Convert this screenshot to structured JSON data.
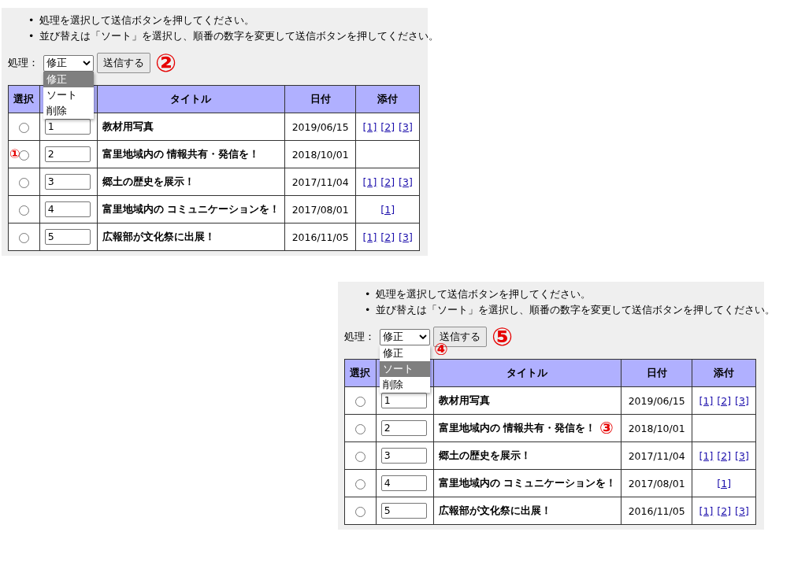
{
  "panels": [
    {
      "bullet": "•",
      "instructions": [
        "処理を選択して送信ボタンを押してください。",
        "並び替えは「ソート」を選択し、順番の数字を変更して送信ボタンを押してください。"
      ],
      "action_label": "処理：",
      "select_value": "修正",
      "options": [
        {
          "label": "修正",
          "selected": true
        },
        {
          "label": "ソート",
          "selected": false
        },
        {
          "label": "削除",
          "selected": false
        }
      ],
      "submit": "送信する",
      "columns": [
        {
          "kind": "select",
          "label": "選択"
        },
        {
          "kind": "order"
        },
        {
          "kind": "title",
          "label": "タイトル"
        },
        {
          "kind": "date",
          "label": "日付"
        },
        {
          "kind": "attach",
          "label": "添付"
        }
      ],
      "rows": [
        {
          "selected": false,
          "order": "1",
          "title": "教材用写真",
          "date": "2019/06/15",
          "attachments": [
            "[1]",
            "[2]",
            "[3]"
          ]
        },
        {
          "selected": false,
          "order": "2",
          "title": "富里地域内の 情報共有・発信を！",
          "date": "2018/10/01",
          "attachments": []
        },
        {
          "selected": false,
          "order": "3",
          "title": "郷土の歴史を展示！",
          "date": "2017/11/04",
          "attachments": [
            "[1]",
            "[2]",
            "[3]"
          ]
        },
        {
          "selected": false,
          "order": "4",
          "title": "富里地域内の コミュニケーションを！",
          "date": "2017/08/01",
          "attachments": [
            "[1]"
          ]
        },
        {
          "selected": false,
          "order": "5",
          "title": "広報部が文化祭に出展！",
          "date": "2016/11/05",
          "attachments": [
            "[1]",
            "[2]",
            "[3]"
          ]
        }
      ],
      "annotations": [
        {
          "kind": "radio",
          "label": "①"
        },
        {
          "kind": "submit",
          "label": "②"
        }
      ]
    },
    {
      "bullet": "•",
      "instructions": [
        "処理を選択して送信ボタンを押してください。",
        "並び替えは「ソート」を選択し、順番の数字を変更して送信ボタンを押してください。"
      ],
      "action_label": "処理：",
      "select_value": "修正",
      "options": [
        {
          "label": "修正",
          "selected": false
        },
        {
          "label": "ソート",
          "selected": true
        },
        {
          "label": "削除",
          "selected": false
        }
      ],
      "submit": "送信する",
      "columns": [
        {
          "kind": "select",
          "label": "選択"
        },
        {
          "kind": "order"
        },
        {
          "kind": "title",
          "label": "タイトル"
        },
        {
          "kind": "date",
          "label": "日付"
        },
        {
          "kind": "attach",
          "label": "添付"
        }
      ],
      "rows": [
        {
          "selected": false,
          "order": "1",
          "title": "教材用写真",
          "date": "2019/06/15",
          "attachments": [
            "[1]",
            "[2]",
            "[3]"
          ]
        },
        {
          "selected": false,
          "order": "2",
          "title": "富里地域内の 情報共有・発信を！",
          "date": "2018/10/01",
          "attachments": []
        },
        {
          "selected": false,
          "order": "3",
          "title": "郷土の歴史を展示！",
          "date": "2017/11/04",
          "attachments": [
            "[1]",
            "[2]",
            "[3]"
          ]
        },
        {
          "selected": false,
          "order": "4",
          "title": "富里地域内の コミュニケーションを！",
          "date": "2017/08/01",
          "attachments": [
            "[1]"
          ]
        },
        {
          "selected": false,
          "order": "5",
          "title": "広報部が文化祭に出展！",
          "date": "2016/11/05",
          "attachments": [
            "[1]",
            "[2]",
            "[3]"
          ]
        }
      ],
      "annotations": [
        {
          "kind": "order",
          "label": "③"
        },
        {
          "kind": "dropdown",
          "label": "④"
        },
        {
          "kind": "submit",
          "label": "⑤"
        }
      ]
    }
  ]
}
